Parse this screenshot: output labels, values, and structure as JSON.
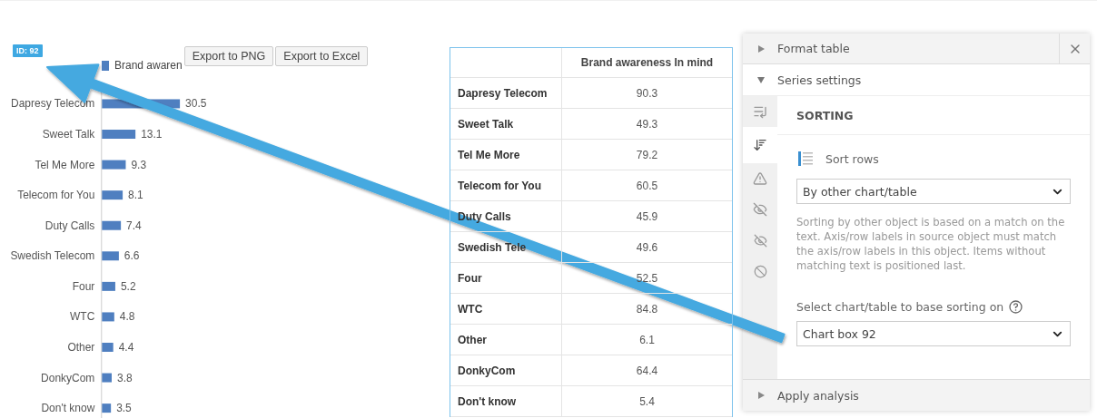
{
  "badge": "ID: 92",
  "buttons": [
    "Export to PNG",
    "Export to Excel"
  ],
  "chart": {
    "chart_data": {
      "type": "bar",
      "orientation": "horizontal",
      "categories": [
        "Dapresy Telecom",
        "Sweet Talk",
        "Tel Me More",
        "Telecom for You",
        "Duty Calls",
        "Swedish Telecom",
        "Four",
        "WTC",
        "Other",
        "DonkyCom",
        "Don't know"
      ],
      "series": [
        {
          "name": "Brand awaren",
          "color": "#4f7fc0",
          "values": [
            30.5,
            13.1,
            9.3,
            8.1,
            7.4,
            6.6,
            5.2,
            4.8,
            4.4,
            3.8,
            3.5
          ]
        }
      ],
      "data_labels": true
    }
  },
  "table": {
    "column_header": "Brand awareness In mind",
    "rows": [
      {
        "label": "Dapresy Telecom",
        "value": "90.3"
      },
      {
        "label": "Sweet Talk",
        "value": "49.3"
      },
      {
        "label": "Tel Me More",
        "value": "79.2"
      },
      {
        "label": "Telecom for You",
        "value": "60.5"
      },
      {
        "label": "Duty Calls",
        "value": "45.9"
      },
      {
        "label": "Swedish Tele",
        "value": "49.6"
      },
      {
        "label": "Four",
        "value": "52.5"
      },
      {
        "label": "WTC",
        "value": "84.8"
      },
      {
        "label": "Other",
        "value": "6.1"
      },
      {
        "label": "DonkyCom",
        "value": "64.4"
      },
      {
        "label": "Don't know",
        "value": "5.4"
      }
    ]
  },
  "panel": {
    "format_section": {
      "title": "Format table",
      "expanded": false
    },
    "series_section": {
      "title": "Series settings",
      "expanded": true
    },
    "side_tabs": [
      {
        "kind": "series",
        "selected": false
      },
      {
        "kind": "sort",
        "selected": true
      },
      {
        "kind": "warning",
        "selected": false
      },
      {
        "kind": "hide",
        "selected": false
      },
      {
        "kind": "hide-lines",
        "selected": false
      },
      {
        "kind": "block",
        "selected": false
      }
    ],
    "heading": "SORTING",
    "sort_label": "Sort rows",
    "sort_select": "By other chart/table",
    "description": "Sorting by other object is based on a match on the text. Axis/row labels in source object must match the axis/row labels in this object. Items without matching text is positioned last.",
    "base_label": "Select chart/table to base sorting on",
    "base_select": "Chart box 92",
    "analysis_section": {
      "title": "Apply analysis",
      "expanded": false
    }
  }
}
